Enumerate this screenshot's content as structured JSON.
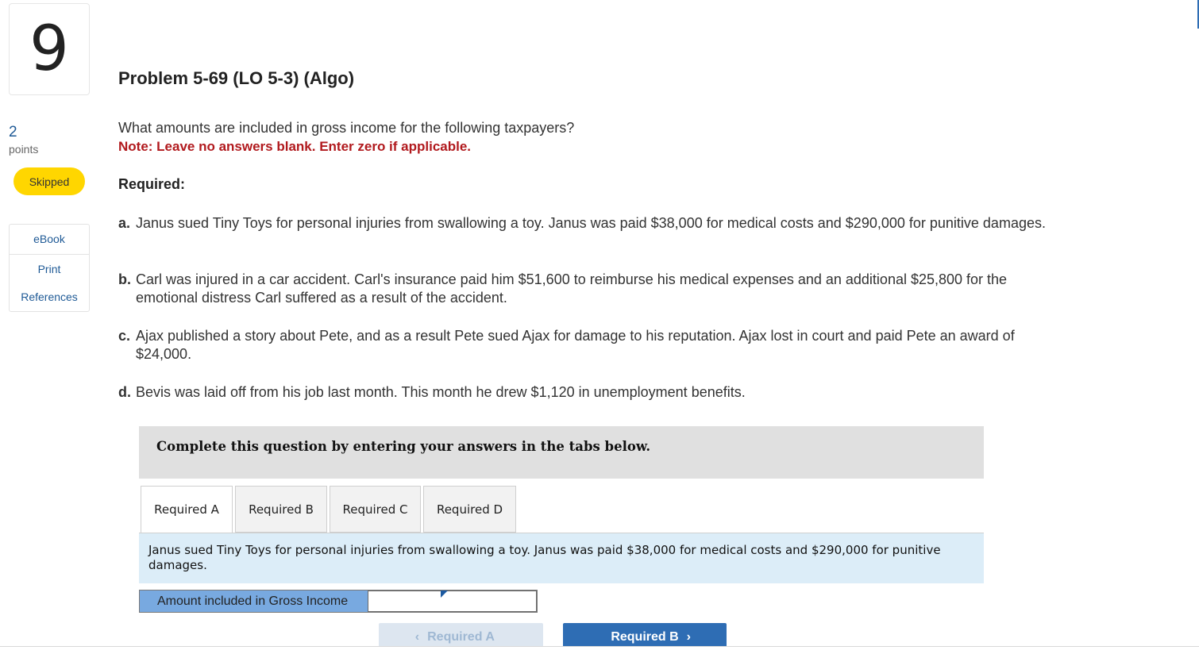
{
  "sidebar": {
    "question_number": "9",
    "points_value": "2",
    "points_label": "points",
    "status_badge": "Skipped",
    "resources": [
      "eBook",
      "Print",
      "References"
    ]
  },
  "problem": {
    "title": "Problem 5-69 (LO 5-3) (Algo)",
    "intro": "What amounts are included in gross income for the following taxpayers?",
    "note": "Note: Leave no answers blank. Enter zero if applicable.",
    "required_label": "Required:",
    "items": [
      {
        "label": "a.",
        "text": "Janus sued Tiny Toys for personal injuries from swallowing a toy. Janus was paid $38,000 for medical costs and $290,000 for punitive damages."
      },
      {
        "label": "b.",
        "text": "Carl was injured in a car accident. Carl's insurance paid him $51,600 to reimburse his medical expenses and an additional $25,800 for the emotional distress Carl suffered as a result of the accident."
      },
      {
        "label": "c.",
        "text": "Ajax published a story about Pete, and as a result Pete sued Ajax for damage to his reputation. Ajax lost in court and paid Pete an award of $24,000."
      },
      {
        "label": "d.",
        "text": "Bevis was laid off from his job last month. This month he drew $1,120 in unemployment benefits."
      }
    ]
  },
  "workspace": {
    "banner": "Complete this question by entering your answers in the tabs below.",
    "tabs": [
      "Required A",
      "Required B",
      "Required C",
      "Required D"
    ],
    "active_tab": "Required A",
    "tab_description": "Janus sued Tiny Toys for personal injuries from swallowing a toy. Janus was paid $38,000 for medical costs and $290,000 for punitive damages.",
    "answer_label": "Amount included in Gross Income",
    "answer_value": "",
    "prev_button": "Required A",
    "next_button": "Required B"
  },
  "colors": {
    "accent": "#2e6db4",
    "note_red": "#b1191d",
    "badge_yellow": "#ffd600",
    "answer_label_bg": "#78a9e0",
    "description_bg": "#dcedf8"
  }
}
